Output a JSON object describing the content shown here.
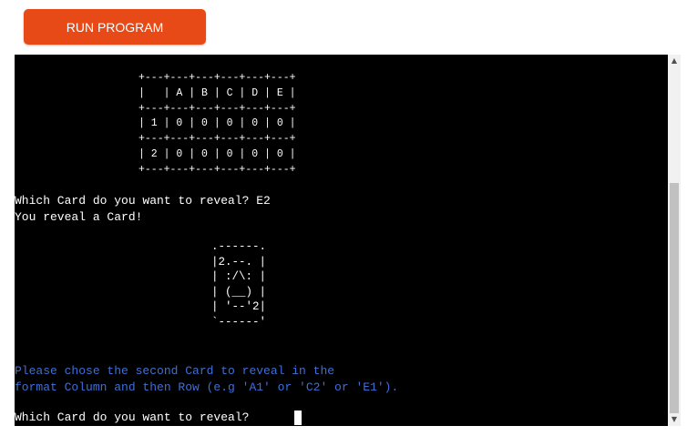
{
  "toolbar": {
    "run_label": "RUN PROGRAM"
  },
  "terminal": {
    "board_ascii": "+---+---+---+---+---+---+\n|   | A | B | C | D | E |\n+---+---+---+---+---+---+\n| 1 | 0 | 0 | 0 | 0 | 0 |\n+---+---+---+---+---+---+\n| 2 | 0 | 0 | 0 | 0 | 0 |\n+---+---+---+---+---+---+",
    "prompt_1": "Which Card do you want to reveal? E2",
    "reveal_msg": "You reveal a Card!",
    "card_ascii": ".------.\n|2.--. |\n| :/\\: |\n| (__) |\n| '--'2|\n`------'",
    "info_line_1": "Please chose the second Card to reveal in the",
    "info_line_2": "format Column and then Row (e.g 'A1' or 'C2' or 'E1').",
    "prompt_2": "Which Card do you want to reveal? "
  },
  "scrollbar": {
    "up_icon": "scroll-up-arrow-icon",
    "down_icon": "scroll-down-arrow-icon"
  },
  "colors": {
    "button": "#e84a17",
    "terminal_bg": "#000000",
    "terminal_fg": "#ffffff",
    "info_text": "#3f6fd6"
  }
}
